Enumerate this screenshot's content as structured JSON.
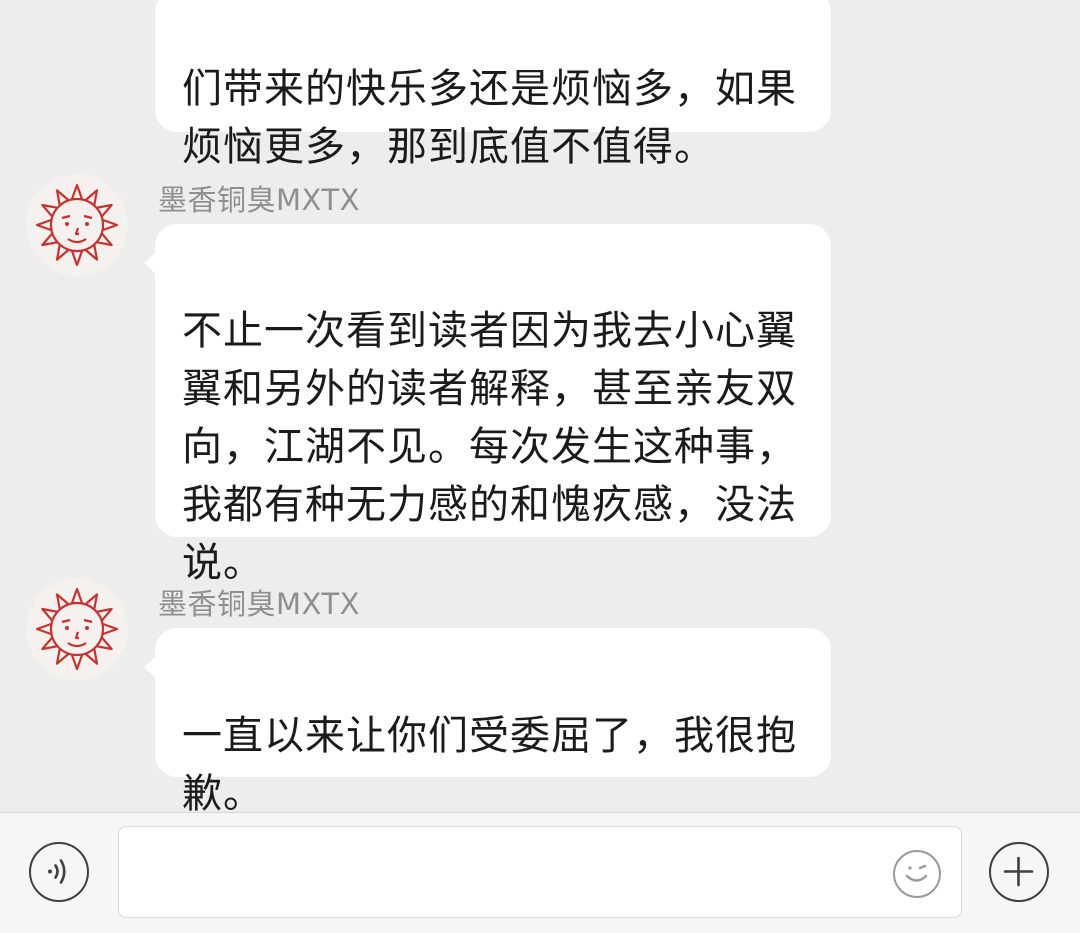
{
  "messages": [
    {
      "sender": "",
      "text": "们带来的快乐多还是烦恼多，如果\n烦恼更多，那到底值不值得。"
    },
    {
      "sender": "墨香铜臭MXTX",
      "text": "不止一次看到读者因为我去小心翼\n翼和另外的读者解释，甚至亲友双\n向，江湖不见。每次发生这种事，\n我都有种无力感的和愧疚感，没法\n说。"
    },
    {
      "sender": "墨香铜臭MXTX",
      "text": "一直以来让你们受委屈了，我很抱\n歉。"
    }
  ],
  "avatar_icon": "sunflower-avatar-icon",
  "input_bar": {
    "voice_icon": "voice-icon",
    "text_value": "",
    "emoji_icon": "emoji-icon",
    "plus_icon": "plus-icon"
  },
  "colors": {
    "chat_background": "#ededed",
    "bubble_background": "#ffffff",
    "message_text": "#1b1b1b",
    "sender_name": "#8f8f8f",
    "avatar_line": "#c8322e"
  }
}
